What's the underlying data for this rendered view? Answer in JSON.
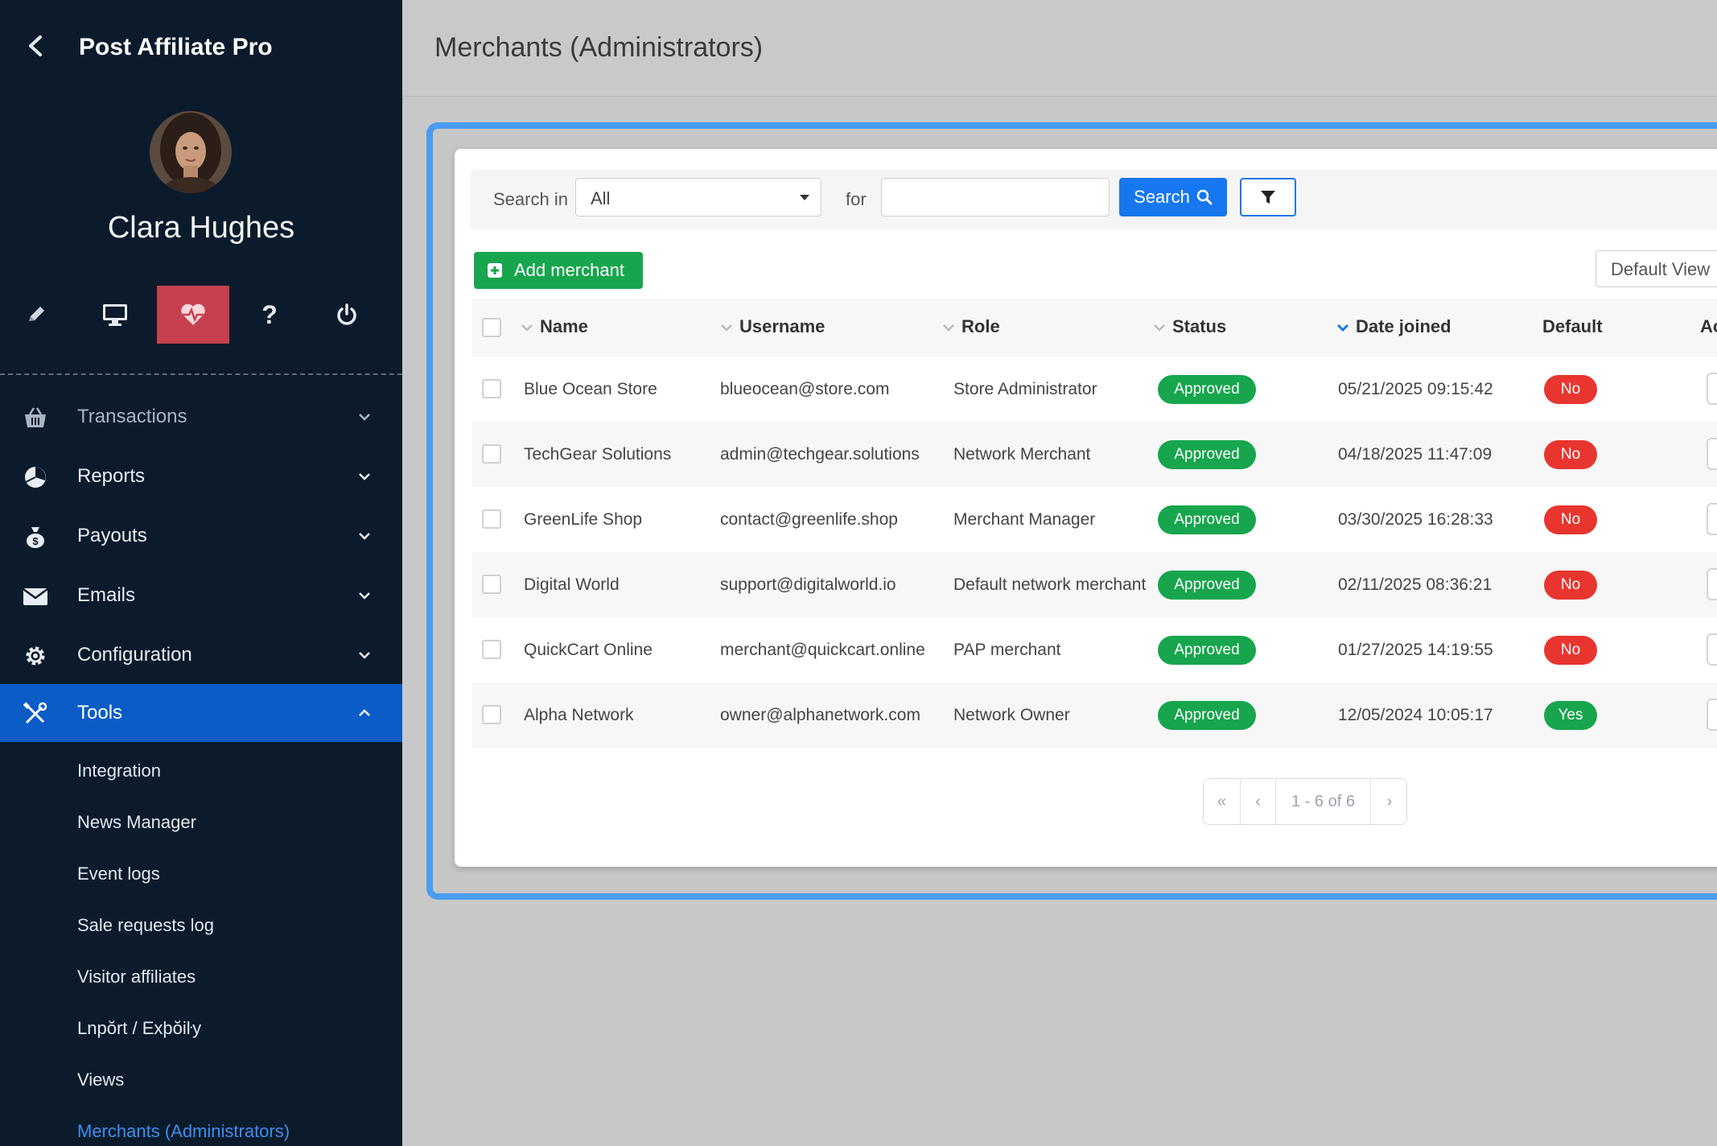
{
  "app": {
    "title": "Post Affiliate Pro"
  },
  "user": {
    "name": "Clara Hughes"
  },
  "quick_icons": [
    {
      "name": "edit-icon",
      "active": false
    },
    {
      "name": "monitor-icon",
      "active": false
    },
    {
      "name": "heartbeat-icon",
      "active": true
    },
    {
      "name": "help-icon",
      "active": false
    },
    {
      "name": "power-icon",
      "active": false
    }
  ],
  "menu": {
    "transactions": "Transactions",
    "reports": "Reports",
    "payouts": "Payouts",
    "emails": "Emails",
    "configuration": "Configuration",
    "tools": "Tools"
  },
  "tools_sub": [
    "Integration",
    "News Manager",
    "Event logs",
    "Sale requests log",
    "Visitor affiliates",
    "Lnpŏrt / Exþŏiŀy",
    "Views",
    "Merchants (Administrators)"
  ],
  "page": {
    "title": "Merchants (Administrators)"
  },
  "search": {
    "search_in_label": "Search in",
    "scope_value": "All",
    "for_label": "for",
    "query_value": "",
    "button_label": "Search"
  },
  "toolbar": {
    "add_label": "Add merchant",
    "view_label": "Default View"
  },
  "table": {
    "columns": {
      "name": "Name",
      "username": "Username",
      "role": "Role",
      "status": "Status",
      "date": "Date joined",
      "default": "Default",
      "actions": "Ac"
    },
    "rows": [
      {
        "name": "Blue Ocean Store",
        "username": "blueocean@store.com",
        "role": "Store Administrator",
        "status": "Approved",
        "date": "05/21/2025 09:15:42",
        "default": "No"
      },
      {
        "name": "TechGear Solutions",
        "username": "admin@techgear.solutions",
        "role": "Network Merchant",
        "status": "Approved",
        "date": "04/18/2025 11:47:09",
        "default": "No"
      },
      {
        "name": "GreenLife Shop",
        "username": "contact@greenlife.shop",
        "role": "Merchant Manager",
        "status": "Approved",
        "date": "03/30/2025 16:28:33",
        "default": "No"
      },
      {
        "name": "Digital World",
        "username": "support@digitalworld.io",
        "role": "Default network merchant",
        "status": "Approved",
        "date": "02/11/2025 08:36:21",
        "default": "No"
      },
      {
        "name": "QuickCart Online",
        "username": "merchant@quickcart.online",
        "role": "PAP merchant",
        "status": "Approved",
        "date": "01/27/2025 14:19:55",
        "default": "No"
      },
      {
        "name": "Alpha Network",
        "username": "owner@alphanetwork.com",
        "role": "Network Owner",
        "status": "Approved",
        "date": "12/05/2024 10:05:17",
        "default": "Yes"
      }
    ]
  },
  "pagination": {
    "first": "«",
    "prev": "‹",
    "range": "1 - 6 of 6",
    "next": "›"
  },
  "colors": {
    "sidebar_bg": "#0c1b2b",
    "active_menu": "#0b5cc7",
    "active_quick_icon": "#c6404f",
    "primary_button": "#1677ee",
    "success": "#17a54d",
    "danger": "#e8352f",
    "frame_border": "#4a9cf0"
  }
}
